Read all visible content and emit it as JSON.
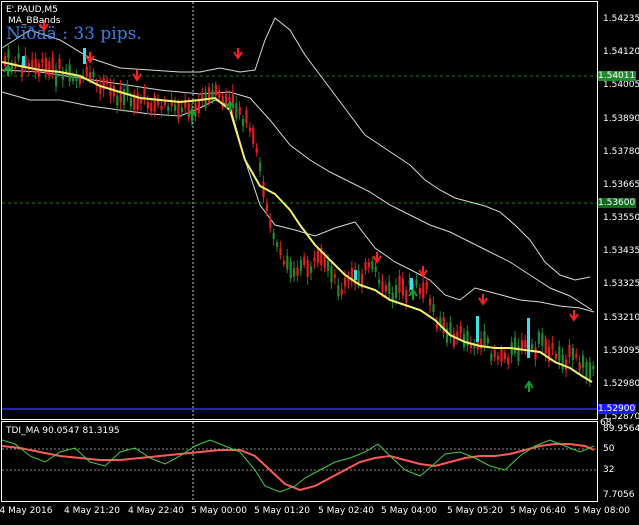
{
  "chart": {
    "symbol": "E'.PAUD,M5",
    "indicator": "MA_BBands",
    "pips_text": "Nïðàä : 33 pips.",
    "current_price_tag": "1.54011",
    "level_tag": "1.53600",
    "bottom_tag": "1.52900",
    "price_labels": [
      "1.54235",
      "1.54120",
      "1.54005",
      "1.53890",
      "1.53780",
      "1.53665",
      "1.53550",
      "1.53435",
      "1.53325",
      "1.53210",
      "1.53095",
      "1.52980",
      "1.52870"
    ],
    "time_labels": [
      "4 May 2016",
      "4 May 21:20",
      "4 May 22:40",
      "5 May 00:00",
      "5 May 01:20",
      "5 May 02:40",
      "5 May 04:00",
      "5 May 05:20",
      "5 May 06:40",
      "5 May 08:00"
    ]
  },
  "oscillator": {
    "title": "TDI_MA 90.0547 81.3195",
    "top_value": "89.9564",
    "levels": [
      "68",
      "50",
      "32"
    ],
    "bottom_value": "7.7056"
  },
  "colors": {
    "background": "#000000",
    "axis": "#ffffff",
    "bull_candle": "#1f8a2e",
    "bear_candle": "#e02020",
    "ma_line": "#f4f06a",
    "bands": "#d8d8d8",
    "down_arrow": "#ff2020",
    "up_arrow": "#10a030",
    "marker": "#40e0e8",
    "level_line": "#1f7a1f",
    "osc_red": "#ff5a5a",
    "osc_green": "#40d040",
    "pips_text": "#3d7fe6"
  }
}
